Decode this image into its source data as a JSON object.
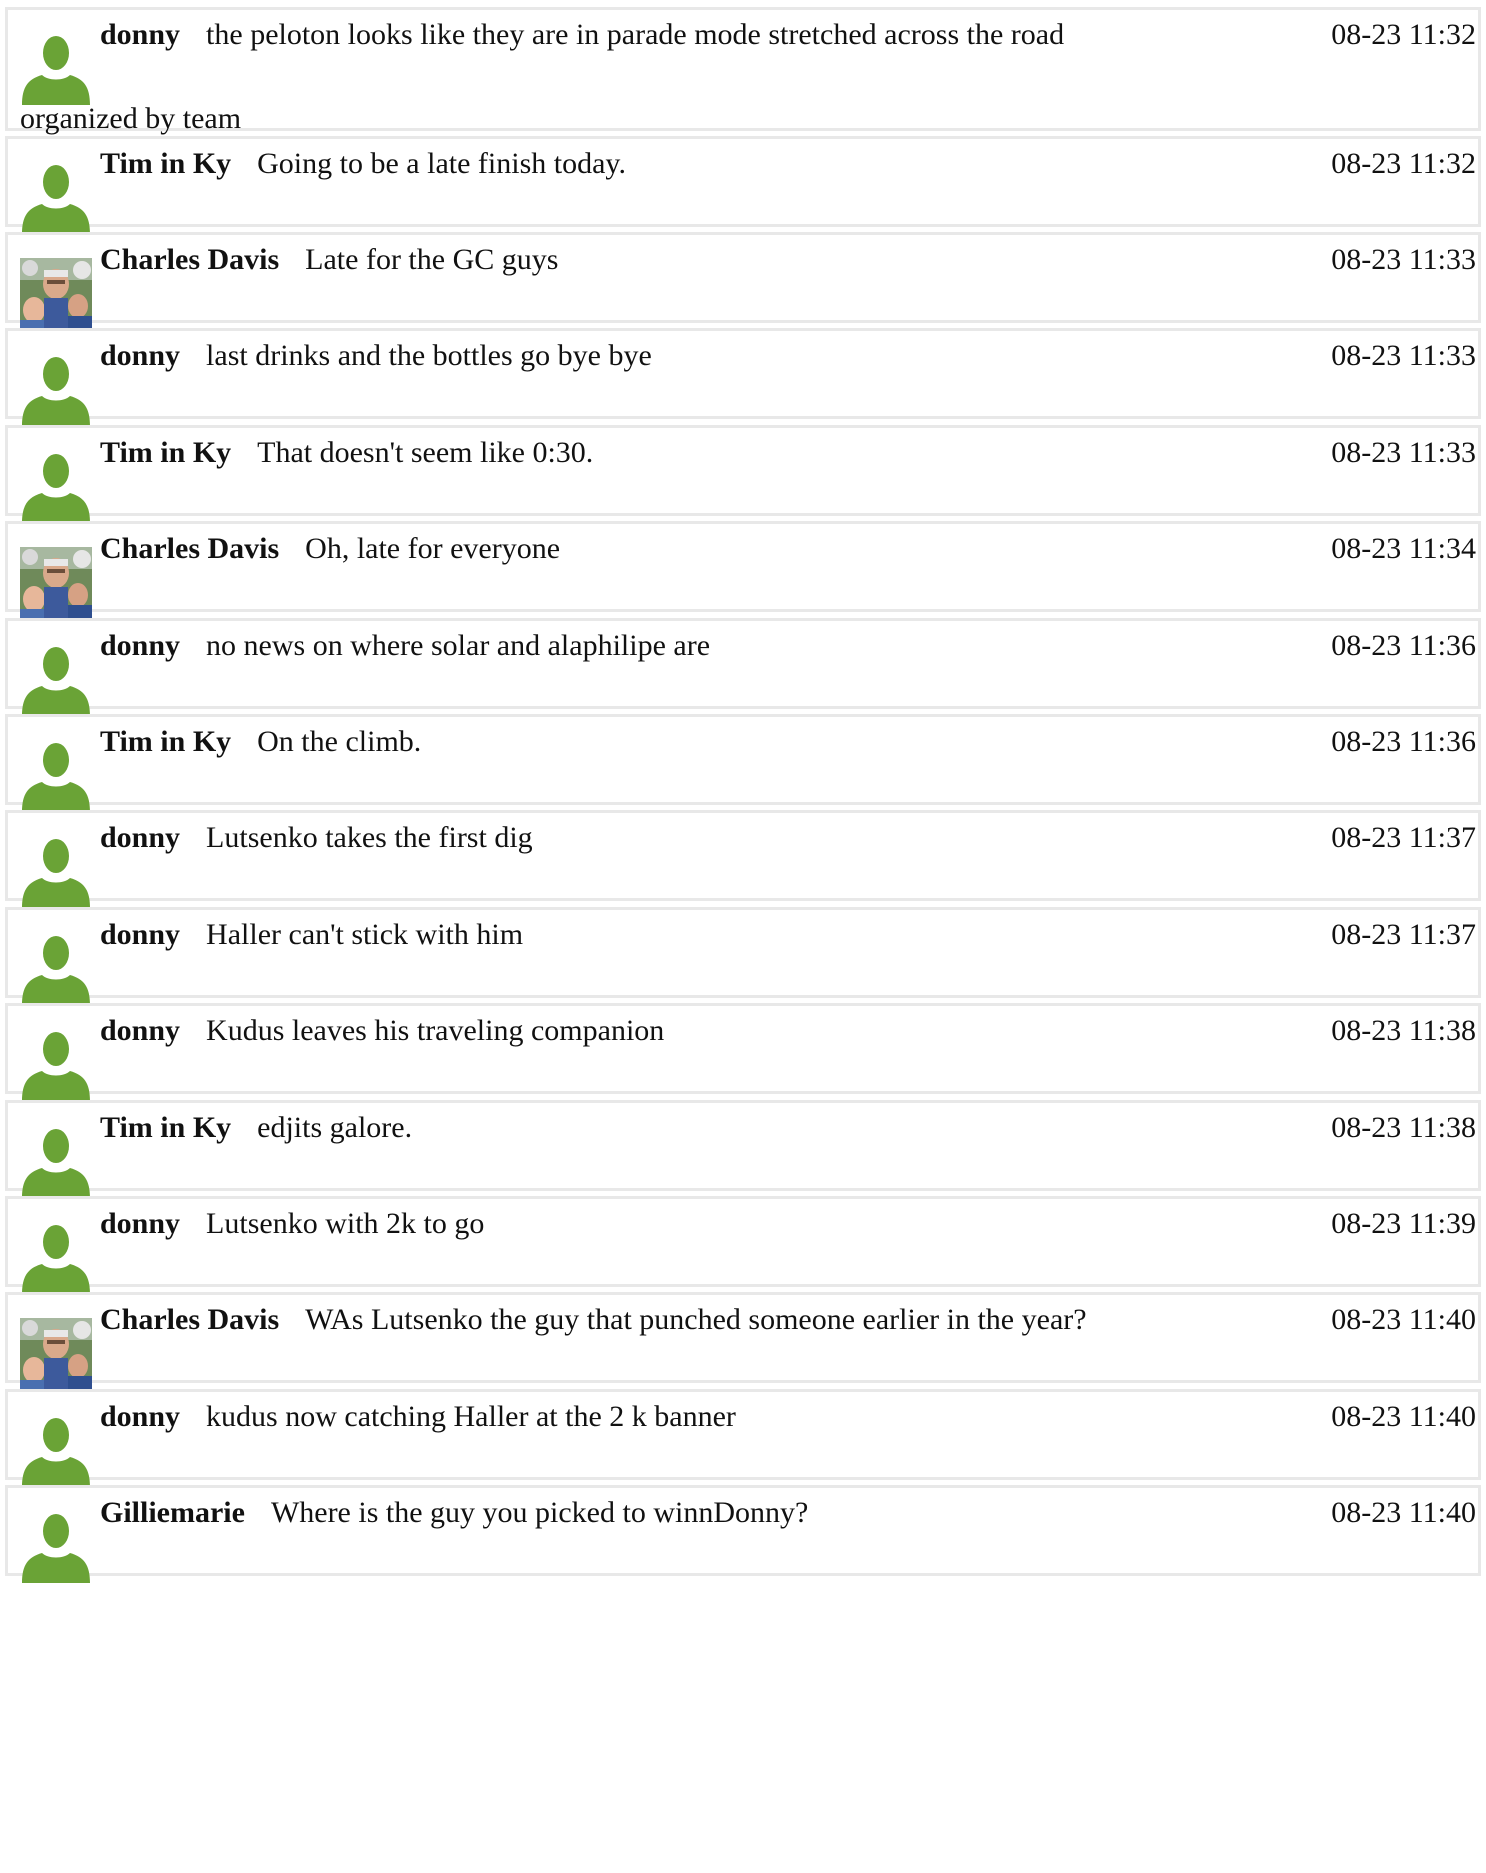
{
  "colors": {
    "avatar_default": "#6aa336",
    "row_border": "#e8e8e8"
  },
  "messages": [
    {
      "user": "donny",
      "avatar": "default-user-icon",
      "text": "the peloton looks like they are in parade mode stretched across the road",
      "text_cont": "organized by team",
      "time": "08-23 11:32"
    },
    {
      "user": "Tim in Ky",
      "avatar": "default-user-icon",
      "text": "Going to be a late finish today.",
      "time": "08-23 11:32"
    },
    {
      "user": "Charles Davis",
      "avatar": "photo-avatar",
      "text": "Late for the GC guys",
      "time": "08-23 11:33"
    },
    {
      "user": "donny",
      "avatar": "default-user-icon",
      "text": "last drinks and the bottles go bye bye",
      "time": "08-23 11:33"
    },
    {
      "user": "Tim in Ky",
      "avatar": "default-user-icon",
      "text": "That doesn't seem like 0:30.",
      "time": "08-23 11:33"
    },
    {
      "user": "Charles Davis",
      "avatar": "photo-avatar",
      "text": "Oh, late for everyone",
      "time": "08-23 11:34"
    },
    {
      "user": "donny",
      "avatar": "default-user-icon",
      "text": "no news on where solar and alaphilipe are",
      "time": "08-23 11:36"
    },
    {
      "user": "Tim in Ky",
      "avatar": "default-user-icon",
      "text": "On the climb.",
      "time": "08-23 11:36"
    },
    {
      "user": "donny",
      "avatar": "default-user-icon",
      "text": "Lutsenko takes the first dig",
      "time": "08-23 11:37"
    },
    {
      "user": "donny",
      "avatar": "default-user-icon",
      "text": "Haller can't stick with him",
      "time": "08-23 11:37"
    },
    {
      "user": "donny",
      "avatar": "default-user-icon",
      "text": "Kudus leaves his traveling companion",
      "time": "08-23 11:38"
    },
    {
      "user": "Tim in Ky",
      "avatar": "default-user-icon",
      "text": "edjits galore.",
      "time": "08-23 11:38"
    },
    {
      "user": "donny",
      "avatar": "default-user-icon",
      "text": "Lutsenko with 2k to go",
      "time": "08-23 11:39"
    },
    {
      "user": "Charles Davis",
      "avatar": "photo-avatar",
      "text": "WAs Lutsenko the guy that punched someone earlier in the year?",
      "time": "08-23 11:40"
    },
    {
      "user": "donny",
      "avatar": "default-user-icon",
      "text": "kudus now catching Haller at the 2 k banner",
      "time": "08-23 11:40"
    },
    {
      "user": "Gilliemarie",
      "avatar": "default-user-icon",
      "text": "Where is the guy you picked to winnDonny?",
      "time": "08-23 11:40"
    }
  ]
}
